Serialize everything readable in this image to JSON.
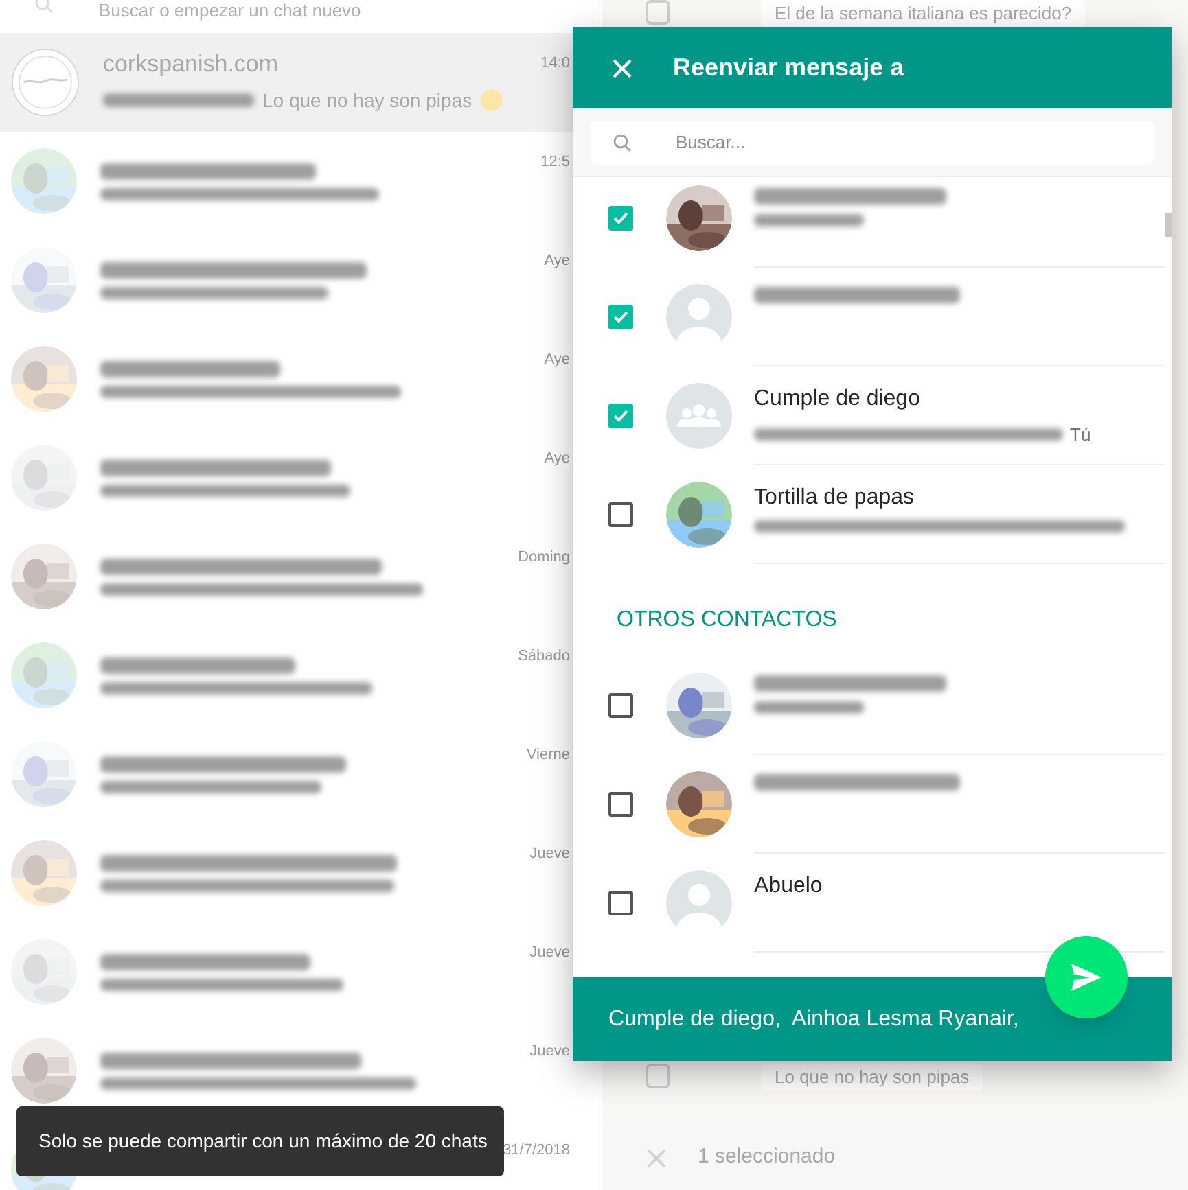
{
  "chat_list": {
    "search_placeholder": "Buscar o empezar un chat nuevo",
    "chats": [
      {
        "name": "corkspanish.com",
        "preview": "Lo que no hay son pipas",
        "time": "14:0",
        "selected": true,
        "kind": "logo"
      },
      {
        "time": "12:5",
        "selected": false,
        "kind": "picture"
      },
      {
        "time": "Aye",
        "selected": false,
        "kind": "picture"
      },
      {
        "time": "Aye",
        "selected": false,
        "kind": "picture"
      },
      {
        "time": "Aye",
        "selected": false,
        "kind": "picture"
      },
      {
        "time": "Doming",
        "selected": false,
        "kind": "picture"
      },
      {
        "time": "Sábado",
        "selected": false,
        "kind": "picture"
      },
      {
        "time": "Vierne",
        "selected": false,
        "kind": "picture"
      },
      {
        "time": "Jueve",
        "selected": false,
        "kind": "picture"
      },
      {
        "time": "Jueve",
        "selected": false,
        "kind": "picture"
      },
      {
        "time": "Jueve",
        "selected": false,
        "kind": "picture"
      },
      {
        "time": "31/7/2018",
        "selected": false,
        "kind": "picture"
      }
    ]
  },
  "conversation": {
    "messages": [
      {
        "text": "El de la semana italiana es parecido?",
        "checked": false
      },
      {
        "text": "Lo que no hay son pipas",
        "checked": false
      }
    ],
    "selection_bar": "1 seleccionado"
  },
  "dialog": {
    "title": "Reenviar mensaje a",
    "search_placeholder": "Buscar...",
    "groups": [
      {
        "contacts": [
          {
            "kind": "picture",
            "checked": true
          },
          {
            "kind": "default",
            "checked": true
          },
          {
            "name": "Cumple de diego",
            "kind": "group",
            "checked": true,
            "subtitle_suffix": "Tú"
          },
          {
            "name": "Tortilla de papas",
            "kind": "picture",
            "checked": false
          }
        ]
      },
      {
        "title": "OTROS CONTACTOS",
        "contacts": [
          {
            "kind": "picture",
            "checked": false
          },
          {
            "kind": "picture",
            "checked": false
          },
          {
            "name": "Abuelo",
            "kind": "default",
            "checked": false
          }
        ]
      }
    ],
    "selected_summary": "Cumple de diego,  Ainhoa Lesma Ryanair,"
  },
  "toast": "Solo se puede compartir con un máximo de 20 chats"
}
